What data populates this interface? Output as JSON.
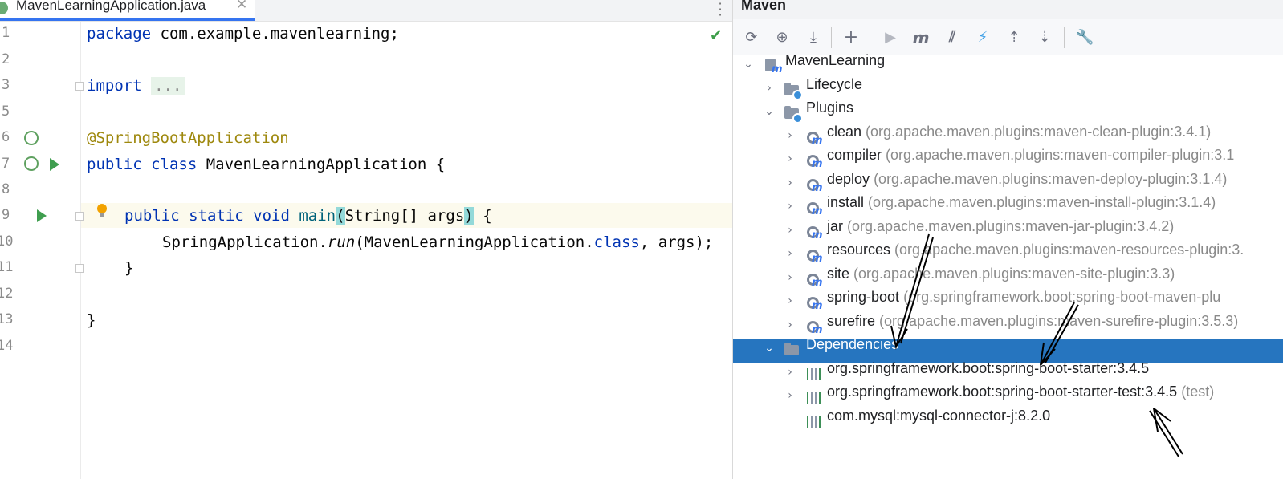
{
  "editor": {
    "tab": {
      "filename": "MavenLearningApplication.java",
      "close": "✕"
    },
    "tab_menu": "⋮",
    "line_numbers": [
      "1",
      "2",
      "3",
      "5",
      "6",
      "7",
      "8",
      "9",
      "10",
      "11",
      "12",
      "13",
      "14"
    ],
    "code": {
      "l1_kw": "package",
      "l1_rest": " com.example.mavenlearning;",
      "l3_kw": "import",
      "l3_fold": "...",
      "l6_ann": "@SpringBootApplication",
      "l7_kw": "public class",
      "l7_rest": " MavenLearningApplication {",
      "l9_kw": "public static void",
      "l9_method": "main",
      "l9_paren_open": "(",
      "l9_params": "String[] args",
      "l9_paren_close": ")",
      "l9_brace": " {",
      "l10_cls": "SpringApplication.",
      "l10_method": "run",
      "l10_args": "(MavenLearningApplication.",
      "l10_kw": "class",
      "l10_end": ", args);",
      "l11": "}",
      "l13": "}"
    }
  },
  "maven": {
    "title": "Maven",
    "toolbar": {
      "reload": "⟳",
      "add_project": "⊕",
      "download": "⤓",
      "add": "+",
      "run": "▶",
      "execute_goal": "m",
      "skip_tests": "⫽",
      "offline": "⚡",
      "expand_all": "⇡",
      "collapse_all": "⇣",
      "settings": "🔧"
    },
    "tree": {
      "project": "MavenLearning",
      "lifecycle": "Lifecycle",
      "plugins": "Plugins",
      "plugin_items": [
        {
          "name": "clean",
          "coord": "(org.apache.maven.plugins:maven-clean-plugin:3.4.1)"
        },
        {
          "name": "compiler",
          "coord": "(org.apache.maven.plugins:maven-compiler-plugin:3.1"
        },
        {
          "name": "deploy",
          "coord": "(org.apache.maven.plugins:maven-deploy-plugin:3.1.4)"
        },
        {
          "name": "install",
          "coord": "(org.apache.maven.plugins:maven-install-plugin:3.1.4)"
        },
        {
          "name": "jar",
          "coord": "(org.apache.maven.plugins:maven-jar-plugin:3.4.2)"
        },
        {
          "name": "resources",
          "coord": "(org.apache.maven.plugins:maven-resources-plugin:3."
        },
        {
          "name": "site",
          "coord": "(org.apache.maven.plugins:maven-site-plugin:3.3)"
        },
        {
          "name": "spring-boot",
          "coord": "(org.springframework.boot:spring-boot-maven-plu"
        },
        {
          "name": "surefire",
          "coord": "(org.apache.maven.plugins:maven-surefire-plugin:3.5.3)"
        }
      ],
      "dependencies": "Dependencies",
      "dependency_items": [
        {
          "name": "org.springframework.boot:spring-boot-starter:3.4.5",
          "scope": ""
        },
        {
          "name": "org.springframework.boot:spring-boot-starter-test:3.4.5",
          "scope": " (test)"
        },
        {
          "name": "com.mysql:mysql-connector-j:8.2.0",
          "scope": ""
        }
      ]
    }
  },
  "colors": {
    "selection": "#2675bf",
    "keyword": "#0033b3",
    "annotation": "#9e880d",
    "method": "#00627a",
    "run_green": "#3f9e4f"
  }
}
